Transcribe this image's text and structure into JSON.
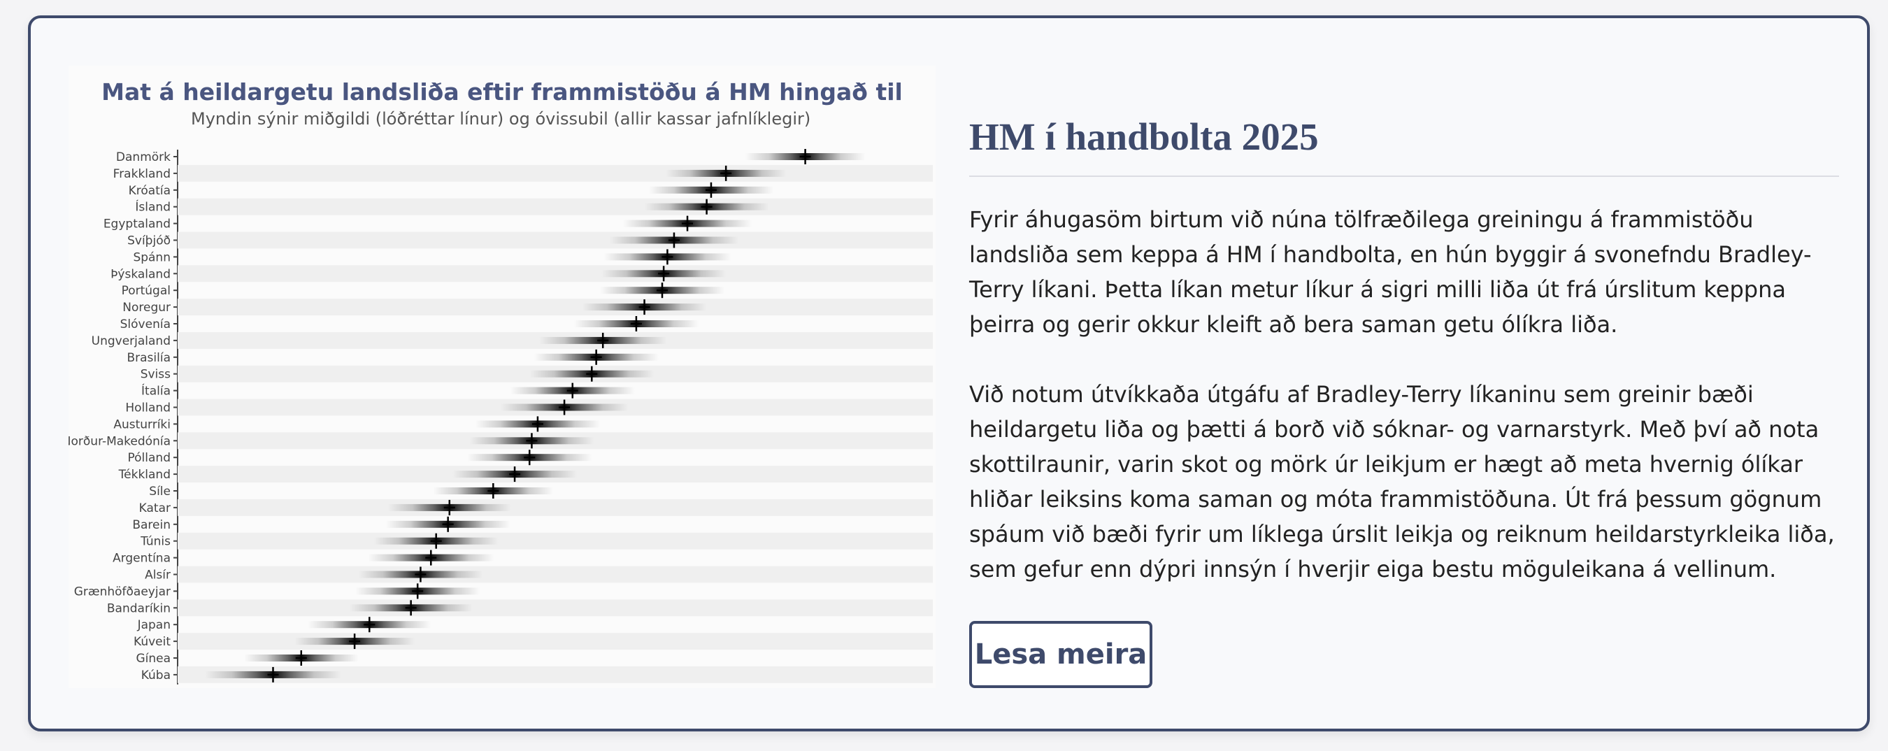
{
  "article": {
    "heading": "HM í handbolta 2025",
    "paragraphs": [
      "Fyrir áhugasöm birtum við núna tölfræðilega greiningu á frammistöðu landsliða sem keppa á HM í handbolta, en hún byggir á svonefndu Bradley-Terry líkani. Þetta líkan metur líkur á sigri milli liða út frá úrslitum keppna þeirra og gerir okkur kleift að bera saman getu ólíkra liða.",
      "Við notum útvíkkaða útgáfu af Bradley-Terry líkaninu sem greinir bæði heildargetu liða og þætti á borð við sóknar- og varnarstyrk. Með því að nota skottilraunir, varin skot og mörk úr leikjum er hægt að meta hvernig ólíkar hliðar leiksins koma saman og móta frammistöðuna. Út frá þessum gögnum spáum við bæði fyrir um líklega úrslit leikja og reiknum heildarstyrkleika liða, sem gefur enn dýpri innsýn í hverjir eiga bestu möguleikana á vellinum."
    ],
    "read_more_label": "Lesa meira"
  },
  "colors": {
    "accent": "#3e4a6b",
    "title": "#4a5680",
    "median_mark": "#000000",
    "band_stripe": "#efefef"
  },
  "chart_data": {
    "type": "scatter",
    "title": "Mat á heildargetu landsliða eftir frammistöðu á HM hingað til",
    "subtitle": "Myndin sýnir miðgildi (lóðréttar línur) og óvissubil (allir kassar jafnlíklegir)",
    "xlabel": "",
    "ylabel": "",
    "x_axis_shown": false,
    "grid": "alternating row bands",
    "legend": "none",
    "xlim": [
      0,
      100
    ],
    "note": "x values are relative positions on the unlabeled ability scale (0 = left edge of plot, 100 = right edge)",
    "teams": [
      {
        "name": "Danmörk",
        "median": 84.3,
        "low": 76.2,
        "high": 92.4
      },
      {
        "name": "Frakkland",
        "median": 73.6,
        "low": 65.5,
        "high": 81.7
      },
      {
        "name": "Króatía",
        "median": 71.6,
        "low": 63.2,
        "high": 80.0
      },
      {
        "name": "Ísland",
        "median": 71.0,
        "low": 62.6,
        "high": 79.4
      },
      {
        "name": "Egyptaland",
        "median": 68.4,
        "low": 59.7,
        "high": 77.1
      },
      {
        "name": "Svíþjóð",
        "median": 66.6,
        "low": 57.9,
        "high": 75.3
      },
      {
        "name": "Spánn",
        "median": 65.7,
        "low": 57.1,
        "high": 74.3
      },
      {
        "name": "Þýskaland",
        "median": 65.2,
        "low": 56.8,
        "high": 73.6
      },
      {
        "name": "Portúgal",
        "median": 65.0,
        "low": 56.6,
        "high": 73.4
      },
      {
        "name": "Noregur",
        "median": 62.6,
        "low": 54.2,
        "high": 71.0
      },
      {
        "name": "Slóvenía",
        "median": 61.5,
        "low": 53.1,
        "high": 69.9
      },
      {
        "name": "Ungverjaland",
        "median": 57.0,
        "low": 48.4,
        "high": 65.6
      },
      {
        "name": "Brasilía",
        "median": 56.1,
        "low": 47.7,
        "high": 64.5
      },
      {
        "name": "Sviss",
        "median": 55.5,
        "low": 47.1,
        "high": 63.9
      },
      {
        "name": "Ítalía",
        "median": 52.9,
        "low": 44.5,
        "high": 61.3
      },
      {
        "name": "Holland",
        "median": 51.8,
        "low": 43.2,
        "high": 60.4
      },
      {
        "name": "Austurríki",
        "median": 48.2,
        "low": 39.8,
        "high": 56.6
      },
      {
        "name": "Norður-Makedónía",
        "median": 47.4,
        "low": 39.0,
        "high": 55.8
      },
      {
        "name": "Pólland",
        "median": 47.1,
        "low": 38.7,
        "high": 55.5
      },
      {
        "name": "Tékkland",
        "median": 45.1,
        "low": 36.7,
        "high": 53.5
      },
      {
        "name": "Síle",
        "median": 42.2,
        "low": 34.1,
        "high": 50.3
      },
      {
        "name": "Katar",
        "median": 36.3,
        "low": 28.0,
        "high": 44.6
      },
      {
        "name": "Barein",
        "median": 36.1,
        "low": 27.7,
        "high": 44.5
      },
      {
        "name": "Túnis",
        "median": 34.5,
        "low": 26.1,
        "high": 42.9
      },
      {
        "name": "Argentína",
        "median": 33.8,
        "low": 25.3,
        "high": 42.3
      },
      {
        "name": "Alsír",
        "median": 32.4,
        "low": 24.0,
        "high": 40.8
      },
      {
        "name": "Grænhöfðaeyjar",
        "median": 32.0,
        "low": 23.6,
        "high": 40.4
      },
      {
        "name": "Bandaríkin",
        "median": 31.1,
        "low": 22.8,
        "high": 39.4
      },
      {
        "name": "Japan",
        "median": 25.5,
        "low": 17.2,
        "high": 33.8
      },
      {
        "name": "Kúveit",
        "median": 23.5,
        "low": 15.4,
        "high": 31.6
      },
      {
        "name": "Gínea",
        "median": 16.3,
        "low": 8.6,
        "high": 24.0
      },
      {
        "name": "Kúba",
        "median": 12.5,
        "low": 3.3,
        "high": 21.7
      }
    ]
  }
}
